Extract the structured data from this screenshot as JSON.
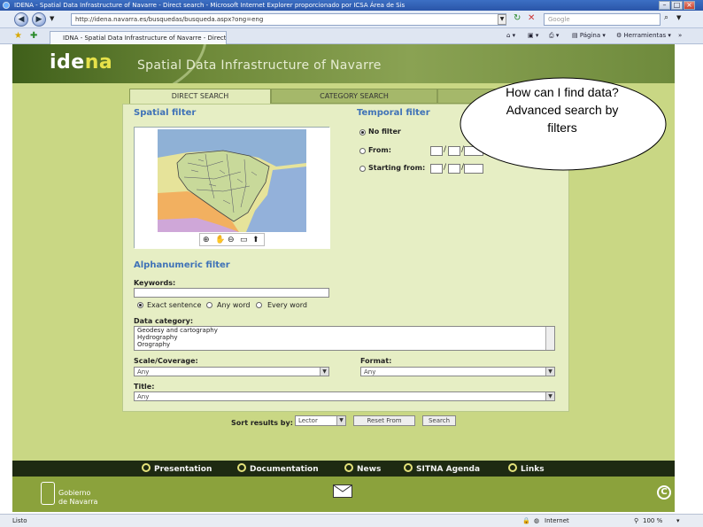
{
  "window": {
    "title": "IDENA - Spatial Data Infrastructure of Navarre - Direct search - Microsoft Internet Explorer proporcionado por ICSA Área de Sis",
    "url": "http://idena.navarra.es/busquedas/busqueda.aspx?ong=eng",
    "search_placeholder": "Google",
    "tab_title": "IDNA - Spatial Data Infrastructure of Navarre - Direct ...",
    "page_menu": "Página",
    "tools_menu": "Herramientas"
  },
  "header": {
    "logo_main": "ide",
    "logo_accent": "na",
    "title": "Spatial Data Infrastructure of Navarre"
  },
  "tabs": [
    "DIRECT SEARCH",
    "CATEGORY SEARCH"
  ],
  "spatial": {
    "title": "Spatial filter"
  },
  "temporal": {
    "title": "Temporal filter",
    "options": [
      "No filter",
      "From:",
      "Starting from:"
    ]
  },
  "alpha": {
    "title": "Alphanumeric filter",
    "keywords_label": "Keywords:",
    "match_options": [
      "Exact sentence",
      "Any word",
      "Every word"
    ],
    "category_label": "Data category:",
    "categories": [
      "Geodesy and cartography",
      "Hydrography",
      "Orography"
    ],
    "scale_label": "Scale/Coverage:",
    "scale_value": "Any",
    "format_label": "Format:",
    "format_value": "Any",
    "title_label": "Title:",
    "title_value": "Any"
  },
  "sort": {
    "label": "Sort results by:",
    "value": "Lector",
    "reset_label": "Reset From",
    "search_label": "Search"
  },
  "footer": {
    "links": [
      "Presentation",
      "Documentation",
      "News",
      "SITNA Agenda",
      "Links"
    ],
    "gov_line1": "Gobierno",
    "gov_line2": "de Navarra",
    "copyright": "C"
  },
  "status": {
    "left": "Listo",
    "zone": "Internet",
    "zoom": "100 %"
  },
  "callout": {
    "text": "How can I find data? Advanced search by filters"
  }
}
